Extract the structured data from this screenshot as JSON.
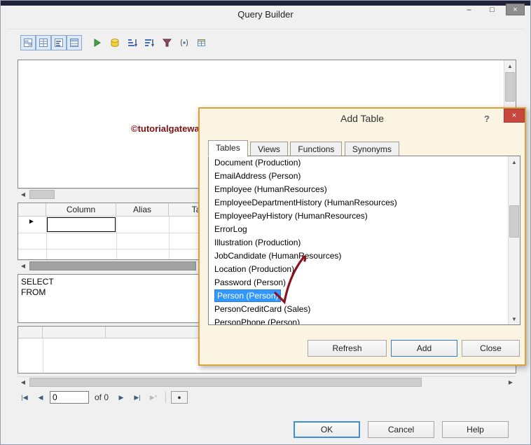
{
  "window": {
    "title": "Query Builder",
    "minimize": "–",
    "maximize": "□",
    "close": "×"
  },
  "toolbar": {
    "icon_names": [
      "show-diagram-pane",
      "show-grid-pane",
      "show-sql-pane",
      "show-results-pane",
      "run-query",
      "verify-sql",
      "sort-ascending",
      "sort-descending",
      "remove-filter",
      "group-by",
      "add-table"
    ]
  },
  "watermark": {
    "text": "©tutorialgateway.org",
    "color": "#7b1113"
  },
  "grid": {
    "columns": [
      "Column",
      "Alias",
      "Table"
    ]
  },
  "sql": {
    "lines": [
      "SELECT",
      "FROM"
    ]
  },
  "navigator": {
    "first": "|◀",
    "previous": "◀",
    "position": "0",
    "of_label": "of 0",
    "next": "▶",
    "last": "▶|",
    "new_row": "▶*",
    "cancel": "●"
  },
  "footer": {
    "ok": "OK",
    "cancel": "Cancel",
    "help": "Help"
  },
  "dialog": {
    "title": "Add Table",
    "help_label": "?",
    "close_label": "×",
    "tabs": [
      "Tables",
      "Views",
      "Functions",
      "Synonyms"
    ],
    "active_tab": "Tables",
    "items": [
      "Document (Production)",
      "EmailAddress (Person)",
      "Employee (HumanResources)",
      "EmployeeDepartmentHistory (HumanResources)",
      "EmployeePayHistory (HumanResources)",
      "ErrorLog",
      "Illustration (Production)",
      "JobCandidate (HumanResources)",
      "Location (Production)",
      "Password (Person)",
      "Person (Person)",
      "PersonCreditCard (Sales)",
      "PersonPhone (Person)"
    ],
    "selected_item": "Person (Person)",
    "selected_index": 10,
    "buttons": {
      "refresh": "Refresh",
      "add": "Add",
      "close": "Close"
    }
  },
  "colors": {
    "dialog_border": "#DDA13C",
    "selection": "#3297FD",
    "dialog_close": "#C7463D",
    "checkmark": "#8B1220",
    "watermark": "#7B1113",
    "focus_border": "#3D8FD6"
  }
}
